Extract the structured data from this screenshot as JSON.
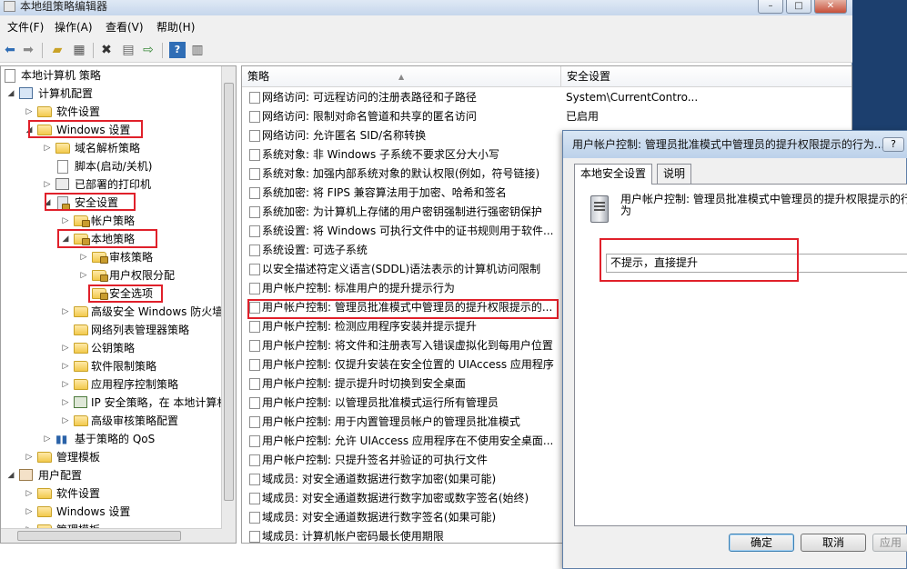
{
  "window": {
    "title": "本地组策略编辑器",
    "controls": {
      "minimize": "–",
      "maximize": "□",
      "close": "✕"
    }
  },
  "menu": [
    "文件(F)",
    "操作(A)",
    "查看(V)",
    "帮助(H)"
  ],
  "toolbar": {
    "icons": [
      "back-icon",
      "forward-icon",
      "up-folder-icon",
      "show-tree-icon",
      "delete-icon",
      "properties-icon",
      "export-icon",
      "help-icon",
      "view-icon"
    ]
  },
  "tree": {
    "items": [
      {
        "label": "本地计算机 策略",
        "icon": "policy"
      },
      {
        "label": "计算机配置",
        "icon": "computer"
      },
      {
        "label": "软件设置",
        "icon": "folder"
      },
      {
        "label": "Windows 设置",
        "icon": "folder"
      },
      {
        "label": "域名解析策略",
        "icon": "folder"
      },
      {
        "label": "脚本(启动/关机)",
        "icon": "doc"
      },
      {
        "label": "已部署的打印机",
        "icon": "printer"
      },
      {
        "label": "安全设置",
        "icon": "security"
      },
      {
        "label": "帐户策略",
        "icon": "folder-lock"
      },
      {
        "label": "本地策略",
        "icon": "folder-lock"
      },
      {
        "label": "审核策略",
        "icon": "folder-lock"
      },
      {
        "label": "用户权限分配",
        "icon": "folder-lock"
      },
      {
        "label": "安全选项",
        "icon": "folder-lock"
      },
      {
        "label": "高级安全 Windows 防火墙",
        "icon": "folder"
      },
      {
        "label": "网络列表管理器策略",
        "icon": "folder"
      },
      {
        "label": "公钥策略",
        "icon": "folder"
      },
      {
        "label": "软件限制策略",
        "icon": "folder"
      },
      {
        "label": "应用程序控制策略",
        "icon": "folder"
      },
      {
        "label": "IP 安全策略，在 本地计算机",
        "icon": "ipsec"
      },
      {
        "label": "高级审核策略配置",
        "icon": "folder"
      },
      {
        "label": "基于策略的 QoS",
        "icon": "chart"
      },
      {
        "label": "管理模板",
        "icon": "folder"
      },
      {
        "label": "用户配置",
        "icon": "user"
      },
      {
        "label": "软件设置",
        "icon": "folder"
      },
      {
        "label": "Windows 设置",
        "icon": "folder"
      },
      {
        "label": "管理模板",
        "icon": "folder"
      }
    ]
  },
  "list": {
    "columns": [
      "策略",
      "安全设置"
    ],
    "rows": [
      {
        "policy": "网络访问: 可远程访问的注册表路径和子路径",
        "value": "System\\CurrentContro..."
      },
      {
        "policy": "网络访问: 限制对命名管道和共享的匿名访问",
        "value": "已启用"
      },
      {
        "policy": "网络访问: 允许匿名 SID/名称转换",
        "value": ""
      },
      {
        "policy": "系统对象: 非 Windows 子系统不要求区分大小写",
        "value": ""
      },
      {
        "policy": "系统对象: 加强内部系统对象的默认权限(例如，符号链接)",
        "value": ""
      },
      {
        "policy": "系统加密: 将 FIPS 兼容算法用于加密、哈希和签名",
        "value": ""
      },
      {
        "policy": "系统加密: 为计算机上存储的用户密钥强制进行强密钥保护",
        "value": ""
      },
      {
        "policy": "系统设置: 将 Windows 可执行文件中的证书规则用于软件...",
        "value": ""
      },
      {
        "policy": "系统设置: 可选子系统",
        "value": ""
      },
      {
        "policy": "以安全描述符定义语言(SDDL)语法表示的计算机访问限制",
        "value": ""
      },
      {
        "policy": "用户帐户控制: 标准用户的提升提示行为",
        "value": ""
      },
      {
        "policy": "用户帐户控制: 管理员批准模式中管理员的提升权限提示的...",
        "value": ""
      },
      {
        "policy": "用户帐户控制: 检测应用程序安装并提示提升",
        "value": ""
      },
      {
        "policy": "用户帐户控制: 将文件和注册表写入错误虚拟化到每用户位置",
        "value": ""
      },
      {
        "policy": "用户帐户控制: 仅提升安装在安全位置的 UIAccess 应用程序",
        "value": ""
      },
      {
        "policy": "用户帐户控制: 提示提升时切换到安全桌面",
        "value": ""
      },
      {
        "policy": "用户帐户控制: 以管理员批准模式运行所有管理员",
        "value": ""
      },
      {
        "policy": "用户帐户控制: 用于内置管理员帐户的管理员批准模式",
        "value": ""
      },
      {
        "policy": "用户帐户控制: 允许 UIAccess 应用程序在不使用安全桌面...",
        "value": ""
      },
      {
        "policy": "用户帐户控制: 只提升签名并验证的可执行文件",
        "value": ""
      },
      {
        "policy": "域成员: 对安全通道数据进行数字加密(如果可能)",
        "value": ""
      },
      {
        "policy": "域成员: 对安全通道数据进行数字加密或数字签名(始终)",
        "value": ""
      },
      {
        "policy": "域成员: 对安全通道数据进行数字签名(如果可能)",
        "value": ""
      },
      {
        "policy": "域成员: 计算机帐户密码最长使用期限",
        "value": ""
      }
    ]
  },
  "dialog": {
    "title": "用户帐户控制: 管理员批准模式中管理员的提升权限提示的行为...",
    "help": "?",
    "tabs": [
      "本地安全设置",
      "说明"
    ],
    "description": "用户帐户控制: 管理员批准模式中管理员的提升权限提示的行为",
    "selected_option": "不提示，直接提升",
    "buttons": {
      "ok": "确定",
      "cancel": "取消",
      "apply": "应用"
    }
  },
  "colors": {
    "highlight_box": "#e0202a",
    "title_bar": "#c6d6ec"
  }
}
